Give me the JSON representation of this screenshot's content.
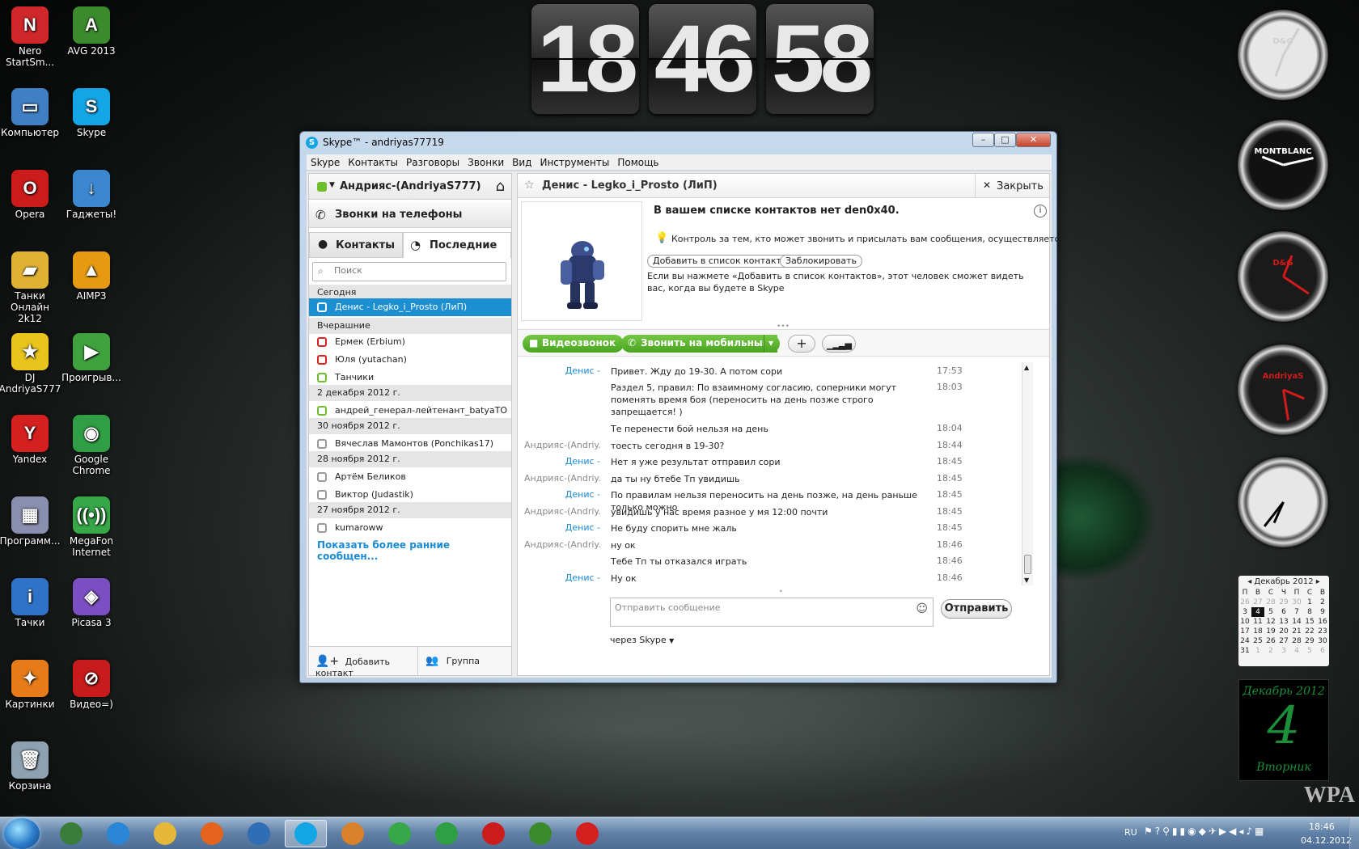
{
  "desktop": {
    "icons": [
      {
        "label": "Nero StartSm...",
        "icon": "nero-icon",
        "color": "#d0282a",
        "glyph": "N"
      },
      {
        "label": "AVG 2013",
        "icon": "avg-icon",
        "color": "#3c8a2e",
        "glyph": "A"
      },
      {
        "label": "Компьютер",
        "icon": "computer-icon",
        "color": "#3f7fc4",
        "glyph": "▭"
      },
      {
        "label": "Skype",
        "icon": "skype-icon",
        "color": "#14a5e7",
        "glyph": "S"
      },
      {
        "label": "Opera",
        "icon": "opera-icon",
        "color": "#cc1b1b",
        "glyph": "O"
      },
      {
        "label": "Гаджеты!",
        "icon": "gadgets-icon",
        "color": "#3c88d0",
        "glyph": "↓"
      },
      {
        "label": "Танки Онлайн 2k12",
        "icon": "folder-icon",
        "color": "#e0b234",
        "glyph": "▰"
      },
      {
        "label": "AIMP3",
        "icon": "aimp-icon",
        "color": "#e69a13",
        "glyph": "▲"
      },
      {
        "label": "DJ AndriyaS777",
        "icon": "star-icon",
        "color": "#e8c41d",
        "glyph": "★"
      },
      {
        "label": "Проигрыв...",
        "icon": "media-player-icon",
        "color": "#3fa23f",
        "glyph": "▶"
      },
      {
        "label": "Yandex",
        "icon": "yandex-icon",
        "color": "#d52020",
        "glyph": "Y"
      },
      {
        "label": "Google Chrome",
        "icon": "chrome-icon",
        "color": "#2f9e44",
        "glyph": "◉"
      },
      {
        "label": "Программ...",
        "icon": "programs-icon",
        "color": "#8a8fb0",
        "glyph": "▦"
      },
      {
        "label": "MegaFon Internet",
        "icon": "megafon-icon",
        "color": "#36a848",
        "glyph": "((•))"
      },
      {
        "label": "Тачки",
        "icon": "info-icon",
        "color": "#2f73c9",
        "glyph": "i"
      },
      {
        "label": "Picasa 3",
        "icon": "picasa-icon",
        "color": "#7b4fc2",
        "glyph": "◈"
      },
      {
        "label": "Картинки",
        "icon": "pictures-icon",
        "color": "#e77b18",
        "glyph": "✦"
      },
      {
        "label": "Видео=)",
        "icon": "no-sign-icon",
        "color": "#c81b1b",
        "glyph": "⊘"
      },
      {
        "label": "Корзина",
        "icon": "recycle-bin-icon",
        "color": "#8da1b2",
        "glyph": "🗑"
      }
    ],
    "flip_clock": {
      "hours": "18",
      "minutes": "46",
      "seconds": "58"
    },
    "gadget_clocks": [
      {
        "label": "D&G",
        "face": "#e7e7e7",
        "accent": "#cfcfcf"
      },
      {
        "label": "MONTBLANC",
        "face": "#111",
        "accent": "#ffffff"
      },
      {
        "label": "D&G",
        "face": "#1a1a1a",
        "accent": "#d11b1b"
      },
      {
        "label": "AndriyaS",
        "face": "#1a1a1a",
        "accent": "#d11b1b"
      },
      {
        "label": "",
        "face": "#e7e7e7",
        "accent": "#000000"
      }
    ],
    "calendar": {
      "month_label": "Декабрь 2012",
      "weekdays": [
        "П",
        "В",
        "С",
        "Ч",
        "П",
        "С",
        "В"
      ],
      "weeks": [
        [
          "26",
          "27",
          "28",
          "29",
          "30",
          "1",
          "2"
        ],
        [
          "3",
          "4",
          "5",
          "6",
          "7",
          "8",
          "9"
        ],
        [
          "10",
          "11",
          "12",
          "13",
          "14",
          "15",
          "16"
        ],
        [
          "17",
          "18",
          "19",
          "20",
          "21",
          "22",
          "23"
        ],
        [
          "24",
          "25",
          "26",
          "27",
          "28",
          "29",
          "30"
        ],
        [
          "31",
          "1",
          "2",
          "3",
          "4",
          "5",
          "6"
        ]
      ],
      "today": "4"
    },
    "big_date": {
      "month": "Декабрь 2012",
      "day": "4",
      "weekday": "Вторник"
    },
    "watermark": "WPA"
  },
  "skype": {
    "title": "Skype™ - andriyas77719",
    "window_buttons": {
      "minimize": "–",
      "maximize": "□",
      "close": "✕"
    },
    "menu": [
      "Skype",
      "Контакты",
      "Разговоры",
      "Звонки",
      "Вид",
      "Инструменты",
      "Помощь"
    ],
    "account_name": "Андрияс-(AndriyaS777)",
    "calls_label": "Звонки на телефоны",
    "tabs": {
      "contacts": "Контакты",
      "recent": "Последние"
    },
    "search_placeholder": "Поиск",
    "groups": {
      "today": "Сегодня",
      "yesterday": "Вчерашние",
      "dec2": "2 декабря 2012 г.",
      "nov30": "30 ноября 2012 г.",
      "nov28": "28 ноября 2012 г.",
      "nov27": "27 ноября 2012 г."
    },
    "contacts": {
      "denis": "Денис - Legko_i_Prosto (ЛиП)",
      "ermek": "Ермек (Erbium)",
      "yulia": "Юля (yutachan)",
      "tanchiki": "Танчики",
      "andrey": "андрей_генерал-лейтенант_batyaTO",
      "vyacheslav": "Вячеслав Мамонтов (Ponchikas17)",
      "artem": "Артём Беликов",
      "viktor": "Виктор (Judastik)",
      "kumaroww": "kumaroww"
    },
    "show_earlier": "Показать более ранние сообщен...",
    "add_contact": "Добавить контакт",
    "group": "Группа",
    "chat": {
      "contact_name": "Денис - Legko_i_Prosto (ЛиП)",
      "close_label": "Закрыть",
      "notice_title": "В вашем списке контактов нет den0x40.",
      "notice_hint": "Контроль за тем, кто может звонить и присылать вам сообщения, осуществляется че...",
      "add_to_contacts": "Добавить в список контактов",
      "block": "Заблокировать",
      "add_info": "Если вы нажмете «Добавить в список контактов», этот человек сможет видеть вас, когда вы будете в Skype",
      "video_call": "Видеозвонок",
      "call_mobile": "Звонить на мобильный",
      "compose_placeholder": "Отправить сообщение",
      "send": "Отправить",
      "via": "через Skype",
      "messages": [
        {
          "who": "Денис -",
          "text": "Привет. Жду до 19-30. А потом сори",
          "time": "17:53",
          "mine": false
        },
        {
          "who": "",
          "text": "Раздел 5, правил: По взаимному согласию, соперники могут поменять время боя (переносить на день позже строго запрещается! )",
          "time": "18:03",
          "mine": false
        },
        {
          "who": "",
          "text": "Те перенести бой нельзя на день",
          "time": "18:04",
          "mine": false
        },
        {
          "who": "Андрияс-(Andriy...",
          "text": "тоесть сегодня в 19-30?",
          "time": "18:44",
          "mine": true
        },
        {
          "who": "Денис -",
          "text": "Нет я уже результат отправил сори",
          "time": "18:45",
          "mine": false
        },
        {
          "who": "Андрияс-(Andriy...",
          "text": "да ты ну бтебе Тп увидишь",
          "time": "18:45",
          "mine": true
        },
        {
          "who": "Денис -",
          "text": "По правилам нельзя переносить на день позже, на день раньше только можно",
          "time": "18:45",
          "mine": false
        },
        {
          "who": "Андрияс-(Andriy...",
          "text": "увидишь  у нас время разное у мя 12:00 почти",
          "time": "18:45",
          "mine": true
        },
        {
          "who": "Денис -",
          "text": "Не буду спорить мне жаль",
          "time": "18:45",
          "mine": false
        },
        {
          "who": "Андрияс-(Andriy...",
          "text": "ну ок",
          "time": "18:46",
          "mine": true
        },
        {
          "who": "",
          "text": "Тебе Тп ты отказался играть",
          "time": "18:46",
          "mine": true
        },
        {
          "who": "Денис -",
          "text": "Ну ок",
          "time": "18:46",
          "mine": false
        }
      ]
    }
  },
  "taskbar": {
    "apps": [
      {
        "name": "task-manager",
        "color": "#3a7d3a"
      },
      {
        "name": "internet-explorer",
        "color": "#2a86d6"
      },
      {
        "name": "explorer",
        "color": "#e6b83a"
      },
      {
        "name": "firefox",
        "color": "#e5631d"
      },
      {
        "name": "mail-agent",
        "color": "#2f6db5"
      },
      {
        "name": "skype",
        "color": "#14a5e7"
      },
      {
        "name": "media",
        "color": "#d9822b"
      },
      {
        "name": "megafon",
        "color": "#36a848"
      },
      {
        "name": "chrome",
        "color": "#2f9e44"
      },
      {
        "name": "opera",
        "color": "#cc1b1b"
      },
      {
        "name": "avg",
        "color": "#3c8a2e"
      },
      {
        "name": "yandex",
        "color": "#d52020"
      }
    ],
    "language": "RU",
    "time": "18:46",
    "date": "04.12.2012"
  }
}
